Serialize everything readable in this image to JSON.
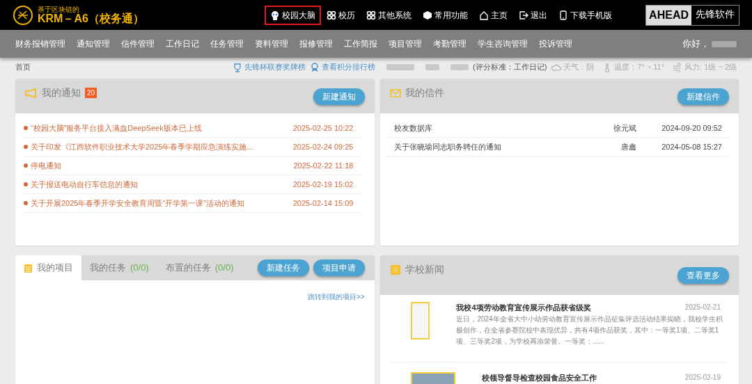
{
  "header": {
    "logo": {
      "tagline": "基于区块链的",
      "title": "KRM－A6（校务通）"
    },
    "links": [
      {
        "label": "校园大脑",
        "highlighted": true
      },
      {
        "label": "校历",
        "highlighted": false
      },
      {
        "label": "其他系统",
        "highlighted": false
      },
      {
        "label": "常用功能",
        "highlighted": false
      },
      {
        "label": "主页",
        "highlighted": false
      },
      {
        "label": "退出",
        "highlighted": false
      },
      {
        "label": "下载手机版",
        "highlighted": false
      }
    ],
    "brand": {
      "left": "AHEAD",
      "right": "先锋软件"
    }
  },
  "nav": {
    "items": [
      "财务报销管理",
      "通知管理",
      "信件管理",
      "工作日记",
      "任务管理",
      "资料管理",
      "报修管理",
      "工作简报",
      "项目管理",
      "考勤管理",
      "学生咨询管理",
      "投诉管理"
    ],
    "greeting": "你好，"
  },
  "breadcrumb": {
    "home": "首页",
    "links": [
      {
        "label": "先锋杯联赛奖牌榜"
      },
      {
        "label": "查看积分排行榜"
      }
    ],
    "rating_note": "(评分标准：工作日记)",
    "weather": [
      {
        "label": "天气：阴"
      },
      {
        "label": "温度：7° ~ 11°"
      },
      {
        "label": "风力: 1级 ~ 2级"
      }
    ]
  },
  "notices": {
    "title": "我的通知",
    "count": "20",
    "button": "新建通知",
    "items": [
      {
        "title": "“校园大脑”服务平台接入满血DeepSeek版本已上线",
        "date": "2025-02-25 10:22"
      },
      {
        "title": "关于印发《江西软件职业技术大学2025年春季学期应急演练实施...",
        "date": "2025-02-24 09:25"
      },
      {
        "title": "停电通知",
        "date": "2025-02-22 11:18"
      },
      {
        "title": "关于报送电动自行车信息的通知",
        "date": "2025-02-19 15:02"
      },
      {
        "title": "关于开展2025年春季开学安全教育周暨“开学第一课”活动的通知",
        "date": "2025-02-14 15:09"
      }
    ]
  },
  "letters": {
    "title": "我的信件",
    "button": "新建信件",
    "items": [
      {
        "subject": "校友数据库",
        "sender": "徐元斌",
        "date": "2024-09-20 09:52"
      },
      {
        "subject": "关于张晓瑜同志职务聘任的通知",
        "sender": "唐鑫",
        "date": "2024-05-08 15:27"
      }
    ]
  },
  "projects": {
    "tabs": [
      {
        "label": "我的项目",
        "selected": true
      },
      {
        "label": "我的任务",
        "count": "(0/0)",
        "selected": false
      },
      {
        "label": "布置的任务",
        "count": "(0/0)",
        "selected": false
      }
    ],
    "buttons": [
      "新建任务",
      "项目申请"
    ],
    "link": "跳转到我的项目>>"
  },
  "news": {
    "title": "学校新闻",
    "button": "查看更多",
    "items": [
      {
        "title": "我校4项劳动教育宣传展示作品获省级奖",
        "date": "2025-02-21",
        "excerpt": "近日，2024年全省大中小幼劳动教育宣传展示作品征集评选活动结果揭晓，我校学生积极创作，在全省参赛院校中表现优异，共有4项作品获奖，其中：一等奖1项、二等奖1项、三等奖2项，为学校再添荣誉。一等奖：......"
      },
      {
        "title": "校领导督导检查校园食品安全工作",
        "date": "2025-02-19"
      }
    ]
  }
}
